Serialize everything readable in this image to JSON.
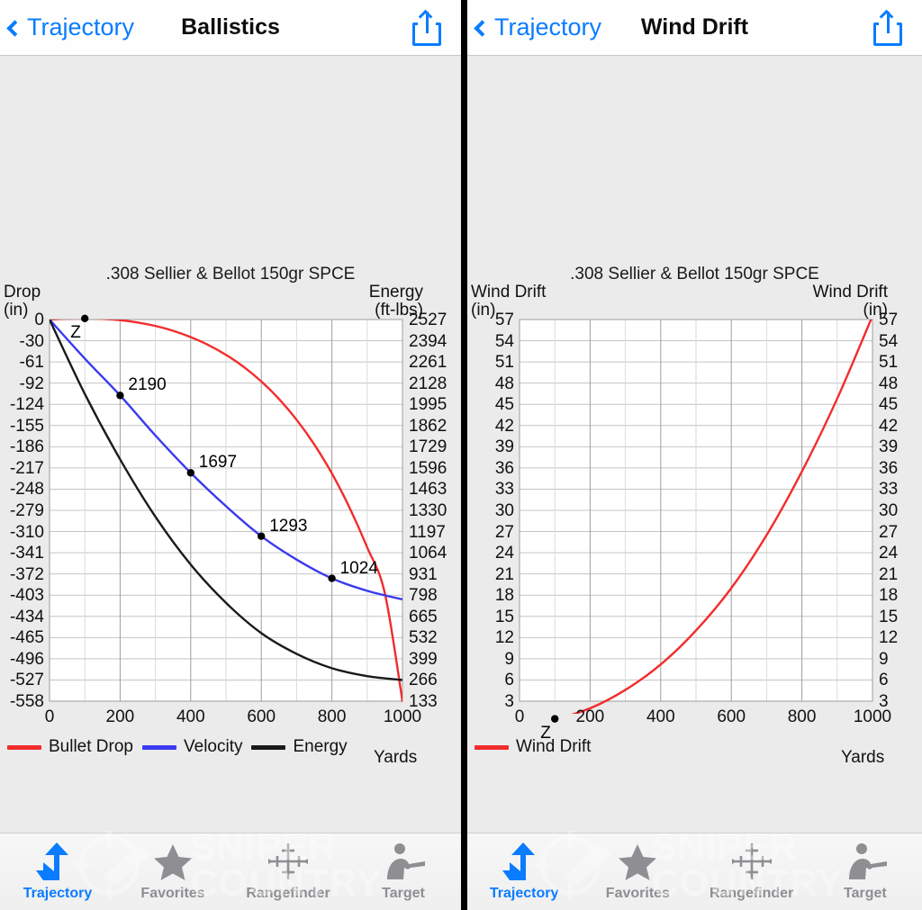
{
  "panes": [
    {
      "nav": {
        "back_label": "Trajectory",
        "title": "Ballistics",
        "share_icon": "share-icon",
        "back_icon": "chevron-left-icon"
      },
      "chart_id": "ballistics"
    },
    {
      "nav": {
        "back_label": "Trajectory",
        "title": "Wind Drift",
        "share_icon": "share-icon",
        "back_icon": "chevron-left-icon"
      },
      "chart_id": "winddrift"
    }
  ],
  "tabs": [
    {
      "label": "Trajectory",
      "icon": "trajectory-arrow-icon",
      "active": true
    },
    {
      "label": "Favorites",
      "icon": "star-icon",
      "active": false
    },
    {
      "label": "Rangefinder",
      "icon": "crosshair-icon",
      "active": false
    },
    {
      "label": "Target",
      "icon": "shooter-icon",
      "active": false
    }
  ],
  "watermark": {
    "line1": "SNIPER",
    "line2": "COUNTRY",
    "icon": "scope-bullet-icon"
  },
  "colors": {
    "accent": "#0a7cff",
    "bullet_drop": "#f22c2c",
    "velocity": "#3a3af0",
    "energy": "#1a1a1a",
    "wind_drift": "#f22c2c",
    "inactive_tab": "#8e8e93",
    "background": "#ebebeb",
    "plot_background": "#ffffff"
  },
  "chart_data": [
    {
      "id": "ballistics",
      "type": "line",
      "title": ".308 Sellier & Bellot 150gr SPCE",
      "xlabel": "Yards",
      "xlim": [
        0,
        1000
      ],
      "xticks": [
        "0",
        "200",
        "400",
        "600",
        "800",
        "1000"
      ],
      "grid": true,
      "legend_position": "bottom-left",
      "left_axis": {
        "label": "Drop",
        "unit": "(in)",
        "ticks": [
          "0",
          "-30",
          "-61",
          "-92",
          "-124",
          "-155",
          "-186",
          "-217",
          "-248",
          "-279",
          "-310",
          "-341",
          "-372",
          "-403",
          "-434",
          "-465",
          "-496",
          "-527",
          "-558"
        ],
        "lim": [
          -558,
          0
        ]
      },
      "right_axis": {
        "label": "Energy",
        "unit": "(ft-lbs)",
        "ticks": [
          "2527",
          "2394",
          "2261",
          "2128",
          "1995",
          "1862",
          "1729",
          "1596",
          "1463",
          "1330",
          "1197",
          "1064",
          "931",
          "798",
          "665",
          "532",
          "399",
          "266",
          "133"
        ],
        "lim": [
          0,
          2527
        ]
      },
      "series": [
        {
          "name": "Bullet Drop",
          "color": "#f22c2c",
          "axis": "left",
          "x": [
            0,
            50,
            100,
            150,
            200,
            250,
            300,
            350,
            400,
            450,
            500,
            550,
            600,
            650,
            700,
            750,
            800,
            850,
            900,
            950,
            1000
          ],
          "values": [
            0,
            1.2,
            1.6,
            0.9,
            -0.9,
            -4.3,
            -9.4,
            -16.4,
            -25.6,
            -37.2,
            -51.6,
            -69.2,
            -90.5,
            -116,
            -146.5,
            -182.5,
            -225,
            -275,
            -333,
            -400,
            -558
          ]
        },
        {
          "name": "Velocity",
          "color": "#3a3af0",
          "axis": "right_scaled",
          "x": [
            0,
            100,
            200,
            300,
            400,
            500,
            600,
            700,
            800,
            900,
            1000
          ],
          "values": [
            2674,
            2425,
            2190,
            1935,
            1697,
            1484,
            1293,
            1144,
            1024,
            945,
            890
          ]
        },
        {
          "name": "Energy",
          "color": "#1a1a1a",
          "axis": "right",
          "x": [
            0,
            100,
            200,
            300,
            400,
            500,
            600,
            700,
            800,
            900,
            1000
          ],
          "values": [
            2527,
            2060,
            1650,
            1290,
            990,
            750,
            560,
            430,
            340,
            290,
            266
          ]
        }
      ],
      "point_labels": [
        {
          "text": "2190",
          "x": 200,
          "series": "Velocity"
        },
        {
          "text": "1697",
          "x": 400,
          "series": "Velocity"
        },
        {
          "text": "1293",
          "x": 600,
          "series": "Velocity"
        },
        {
          "text": "1024",
          "x": 800,
          "series": "Velocity"
        }
      ],
      "zero_marker": {
        "label": "Z",
        "x": 100
      }
    },
    {
      "id": "winddrift",
      "type": "line",
      "title": ".308 Sellier & Bellot 150gr SPCE",
      "xlabel": "Yards",
      "xlim": [
        0,
        1000
      ],
      "xticks": [
        "0",
        "200",
        "400",
        "600",
        "800",
        "1000"
      ],
      "grid": true,
      "legend_position": "bottom-left",
      "left_axis": {
        "label": "Wind Drift",
        "unit": "(in)",
        "ticks": [
          "57",
          "54",
          "51",
          "48",
          "45",
          "42",
          "39",
          "36",
          "33",
          "30",
          "27",
          "24",
          "21",
          "18",
          "15",
          "12",
          "9",
          "6",
          "3"
        ],
        "lim": [
          0,
          57
        ]
      },
      "right_axis": {
        "label": "Wind Drift",
        "unit": "(in)",
        "ticks": [
          "57",
          "54",
          "51",
          "48",
          "45",
          "42",
          "39",
          "36",
          "33",
          "30",
          "27",
          "24",
          "21",
          "18",
          "15",
          "12",
          "9",
          "6",
          "3"
        ],
        "lim": [
          0,
          57
        ]
      },
      "series": [
        {
          "name": "Wind Drift",
          "color": "#f22c2c",
          "axis": "left",
          "x": [
            0,
            100,
            200,
            300,
            400,
            500,
            600,
            700,
            800,
            900,
            1000
          ],
          "values": [
            0,
            0.5,
            2.0,
            4.6,
            8.2,
            13.0,
            19.0,
            26.5,
            35.5,
            45.8,
            57.5
          ]
        }
      ],
      "point_labels": [],
      "zero_marker": {
        "label": "Z",
        "x": 100
      }
    }
  ]
}
